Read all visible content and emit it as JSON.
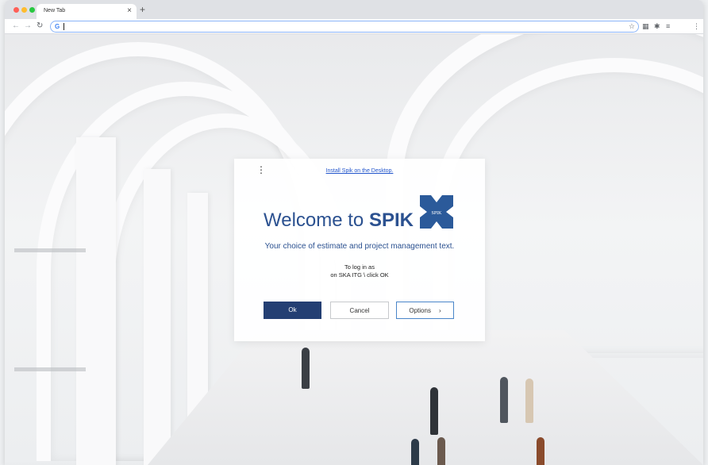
{
  "browser": {
    "tab_title": "New Tab",
    "tab_close": "×",
    "new_tab": "+",
    "back": "←",
    "forward": "→",
    "reload": "↻",
    "omnibox_icon": "G",
    "address_value": "",
    "bookmark_icon": "☆",
    "extensions": [
      "▦",
      "✱",
      "≡"
    ],
    "menu": "⋮"
  },
  "dialog": {
    "menu_icon": "⋮",
    "install_link": "Install Spik on the Desktop.",
    "welcome_prefix": "Welcome to",
    "welcome_brand": "SPIK",
    "logo_text": "SPIK",
    "tagline": "Your choice of estimate and project management text.",
    "login_line1": "To log in as",
    "login_line2": "on SKA ITG \\ click OK",
    "ok_label": "Ok",
    "cancel_label": "Cancel",
    "options_label": "Options",
    "options_chevron": "›"
  },
  "colors": {
    "brand_blue": "#2b5190",
    "ok_button": "#243f73",
    "link": "#2255cc"
  }
}
